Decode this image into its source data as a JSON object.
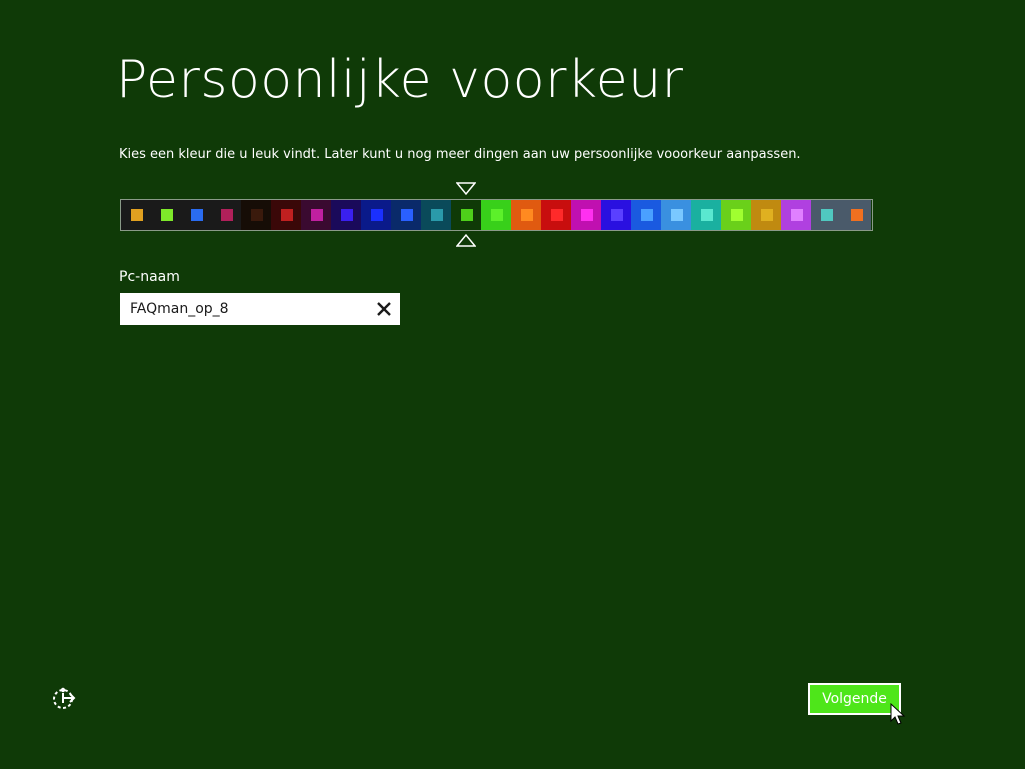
{
  "page": {
    "title": "Persoonlijke voorkeur",
    "subtitle": "Kies een kleur die u leuk vindt. Later kunt u nog meer dingen aan uw persoonlijke vooorkeur aanpassen."
  },
  "palette": {
    "selected_index": 11,
    "swatches": [
      {
        "bg": "#1a1a1a",
        "fg": "#e0a020"
      },
      {
        "bg": "#1a1a1a",
        "fg": "#7ee82a"
      },
      {
        "bg": "#1a1a1a",
        "fg": "#2a6cf0"
      },
      {
        "bg": "#1a1a1a",
        "fg": "#b0205a"
      },
      {
        "bg": "#160d06",
        "fg": "#3a1a0c"
      },
      {
        "bg": "#3a0808",
        "fg": "#c02020"
      },
      {
        "bg": "#3a0a30",
        "fg": "#c020a0"
      },
      {
        "bg": "#1a0a5a",
        "fg": "#3a20f0"
      },
      {
        "bg": "#0a1a8a",
        "fg": "#1a30ff"
      },
      {
        "bg": "#0a2a6a",
        "fg": "#2a60ff"
      },
      {
        "bg": "#0a4a5a",
        "fg": "#2a9aaa"
      },
      {
        "bg": "#0f3a07",
        "fg": "#4ed01a"
      },
      {
        "bg": "#38d01a",
        "fg": "#5cf02a"
      },
      {
        "bg": "#e05a10",
        "fg": "#ff8a20"
      },
      {
        "bg": "#c80e0e",
        "fg": "#ff2a2a"
      },
      {
        "bg": "#c010b0",
        "fg": "#ff30f0"
      },
      {
        "bg": "#2a10e0",
        "fg": "#5a40ff"
      },
      {
        "bg": "#1a5ae0",
        "fg": "#4aa0ff"
      },
      {
        "bg": "#3a90e0",
        "fg": "#7ac8ff"
      },
      {
        "bg": "#1ab0a0",
        "fg": "#5ae8d0"
      },
      {
        "bg": "#6ad01a",
        "fg": "#a0ff30"
      },
      {
        "bg": "#c08a10",
        "fg": "#e0b020"
      },
      {
        "bg": "#b040e0",
        "fg": "#e080ff"
      },
      {
        "bg": "#4a5a6a",
        "fg": "#50c8c0"
      },
      {
        "bg": "#4a5a6a",
        "fg": "#f07020"
      }
    ]
  },
  "pcname": {
    "label": "Pc-naam",
    "value": "FAQman_op_8"
  },
  "footer": {
    "next_label": "Volgende"
  },
  "colors": {
    "background": "#0f3a07",
    "accent": "#4ee61a"
  },
  "icons": {
    "clear": "close-icon",
    "ease_of_access": "ease-of-access-icon",
    "pointer": "mouse-pointer-icon"
  }
}
